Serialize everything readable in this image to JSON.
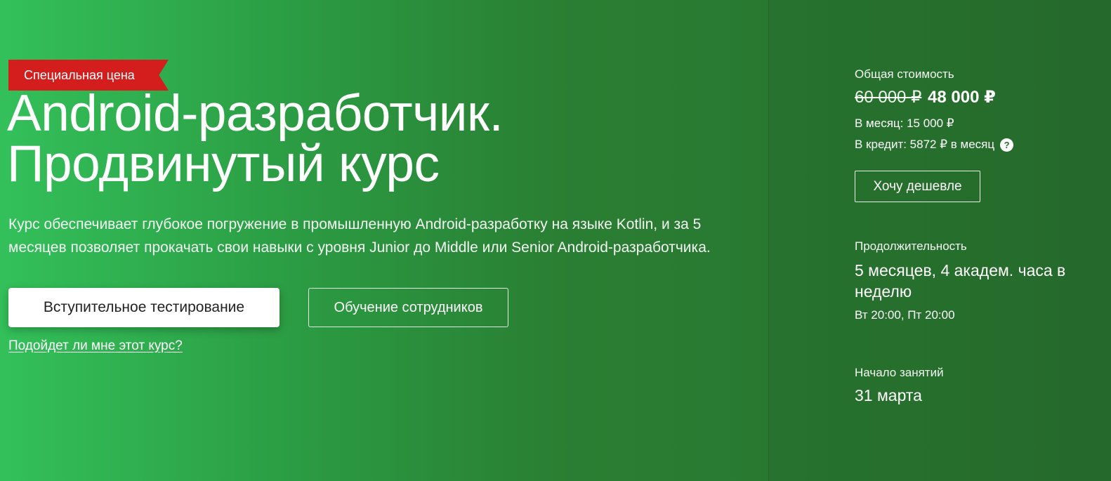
{
  "badge": {
    "label": "Специальная цена"
  },
  "course": {
    "title_line1": "Android-разработчик.",
    "title_line2": "Продвинутый курс",
    "description": "Курс обеспечивает глубокое погружение в промышленную Android-разработку на языке Kotlin, и за 5 месяцев позволяет прокачать свои навыки с уровня Junior до Middle или Senior Android-разработчика."
  },
  "actions": {
    "entrance_test": "Вступительное тестирование",
    "corporate_training": "Обучение сотрудников",
    "fit_link": "Подойдет ли мне этот курс?"
  },
  "pricing": {
    "label": "Общая стоимость",
    "old_price": "60 000 ₽",
    "new_price": "48 000 ₽",
    "monthly": "В месяц: 15 000 ₽",
    "credit": "В кредит: 5872 ₽ в месяц",
    "help_symbol": "?",
    "cheaper_button": "Хочу дешевле"
  },
  "duration": {
    "label": "Продолжительность",
    "value": "5 месяцев, 4 академ. часа в неделю",
    "schedule": "Вт 20:00, Пт 20:00"
  },
  "start": {
    "label": "Начало занятий",
    "value": "31 марта"
  },
  "colors": {
    "gradient_start": "#33c05a",
    "gradient_end": "#276e2e",
    "badge": "#d41e1e"
  },
  "icons": {
    "help": "question-circle-icon"
  }
}
